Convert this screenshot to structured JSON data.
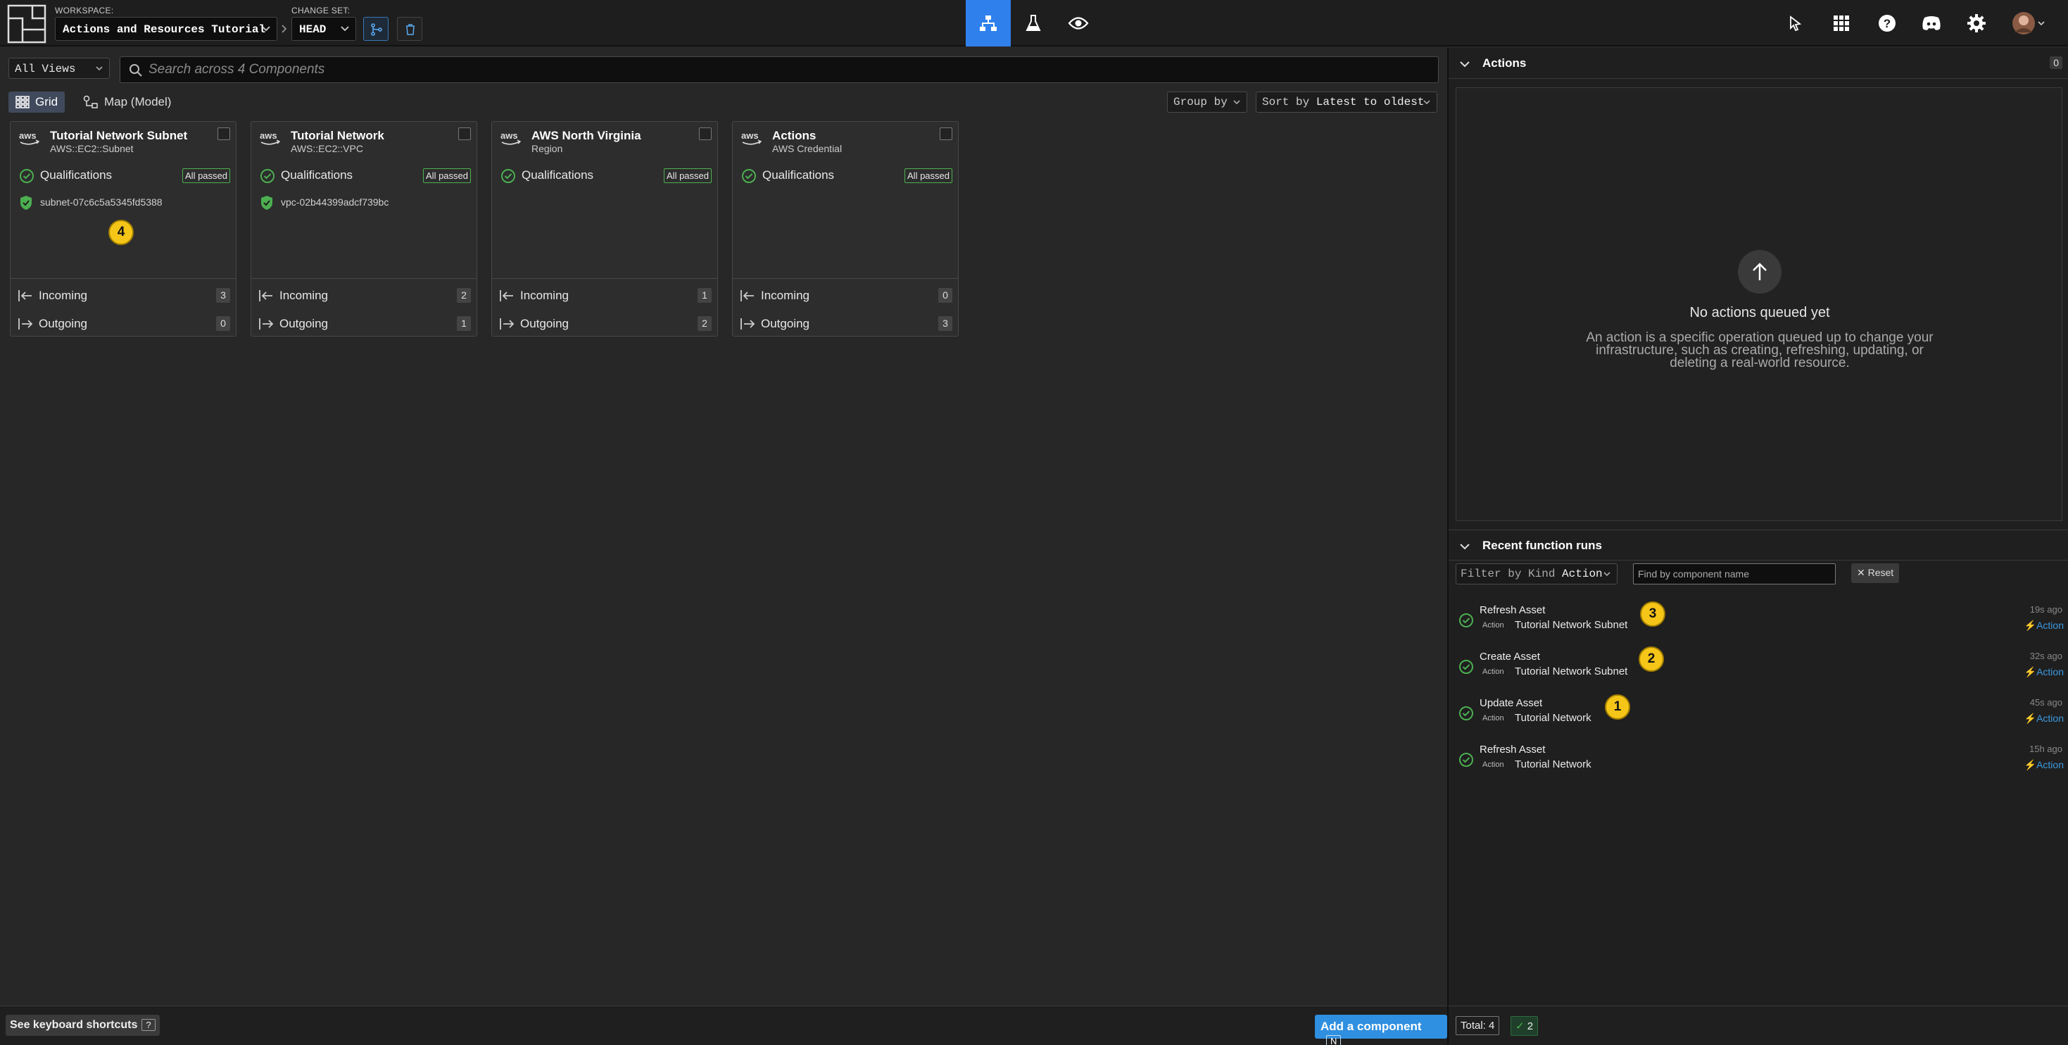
{
  "topbar": {
    "workspace_label": "WORKSPACE:",
    "workspace_value": "Actions and Resources Tutorial",
    "changeset_label": "CHANGE SET:",
    "changeset_value": "HEAD",
    "center_tabs": [
      {
        "icon": "diagram-icon",
        "active": true
      },
      {
        "icon": "flask-icon",
        "active": false
      },
      {
        "icon": "eye-icon",
        "active": false
      }
    ],
    "right_icons": [
      "cursor-icon",
      "apps-grid-icon",
      "help-icon",
      "discord-icon",
      "settings-icon",
      "user-avatar"
    ]
  },
  "left": {
    "views_select": "All Views",
    "search_placeholder": "Search across 4 Components",
    "grid_label": "Grid",
    "map_label": "Map (Model)",
    "group_by_label": "Group by",
    "sort_prefix": "Sort by",
    "sort_value": "Latest to oldest"
  },
  "cards": [
    {
      "title": "Tutorial Network Subnet",
      "subtitle": "AWS::EC2::Subnet",
      "qualifications": "Qualifications",
      "qual_badge": "All passed",
      "resource_id": "subnet-07c6c5a5345fd5388",
      "incoming_label": "Incoming",
      "incoming": "3",
      "outgoing_label": "Outgoing",
      "outgoing": "0"
    },
    {
      "title": "Tutorial Network",
      "subtitle": "AWS::EC2::VPC",
      "qualifications": "Qualifications",
      "qual_badge": "All passed",
      "resource_id": "vpc-02b44399adcf739bc",
      "incoming_label": "Incoming",
      "incoming": "2",
      "outgoing_label": "Outgoing",
      "outgoing": "1"
    },
    {
      "title": "AWS North Virginia",
      "subtitle": "Region",
      "qualifications": "Qualifications",
      "qual_badge": "All passed",
      "resource_id": "",
      "incoming_label": "Incoming",
      "incoming": "1",
      "outgoing_label": "Outgoing",
      "outgoing": "2"
    },
    {
      "title": "Actions",
      "subtitle": "AWS Credential",
      "qualifications": "Qualifications",
      "qual_badge": "All passed",
      "resource_id": "",
      "incoming_label": "Incoming",
      "incoming": "0",
      "outgoing_label": "Outgoing",
      "outgoing": "3"
    }
  ],
  "markers": [
    "4",
    "3",
    "2",
    "1"
  ],
  "bottom_left": {
    "shortcuts_label": "See keyboard shortcuts",
    "shortcuts_key": "?",
    "add_label": "Add a component",
    "add_key": "N"
  },
  "actions_panel": {
    "title": "Actions",
    "count": "0",
    "empty_title": "No actions queued yet",
    "empty_desc": "An action is a specific operation queued up to change your infrastructure, such as creating, refreshing, updating, or deleting a real-world resource."
  },
  "runs_panel": {
    "title": "Recent function runs",
    "filter_prefix": "Filter by Kind",
    "filter_value": "Action",
    "find_placeholder": "Find by component name",
    "reset_label": "Reset",
    "runs": [
      {
        "name": "Refresh Asset",
        "kind": "Action",
        "component": "Tutorial Network Subnet",
        "time": "19s ago",
        "action": "Action"
      },
      {
        "name": "Create Asset",
        "kind": "Action",
        "component": "Tutorial Network Subnet",
        "time": "32s ago",
        "action": "Action"
      },
      {
        "name": "Update Asset",
        "kind": "Action",
        "component": "Tutorial Network",
        "time": "45s ago",
        "action": "Action"
      },
      {
        "name": "Refresh Asset",
        "kind": "Action",
        "component": "Tutorial Network",
        "time": "15h ago",
        "action": "Action"
      }
    ]
  },
  "status": {
    "total": "Total: 4",
    "ok": "2"
  },
  "colors": {
    "accent": "#2f80ed",
    "success": "#4caf50",
    "marker": "#f5c518",
    "link": "#3b9ae0"
  }
}
